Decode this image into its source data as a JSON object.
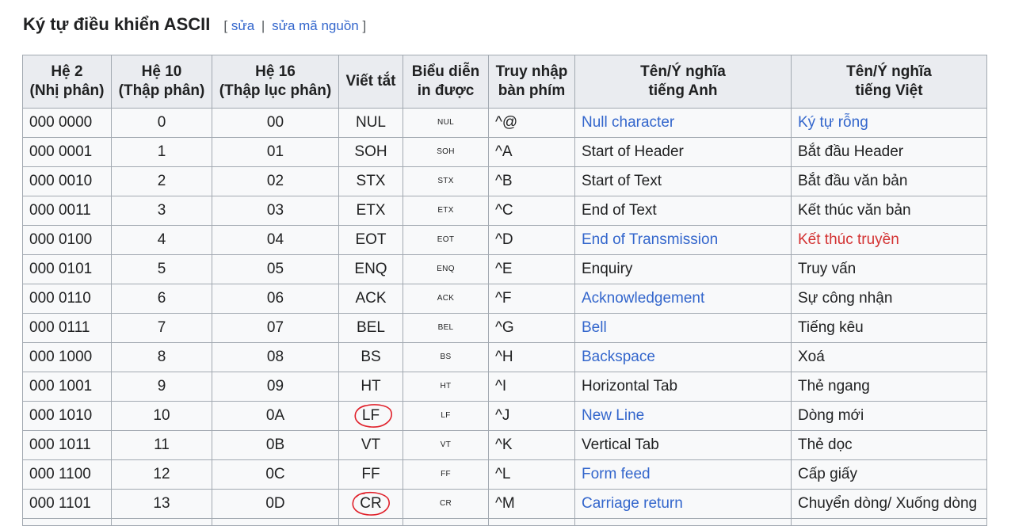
{
  "section": {
    "title": "Ký tự điều khiển ASCII",
    "edit_open": "[",
    "edit_label": "sửa",
    "separator": "|",
    "edit_source_label": "sửa mã nguồn",
    "edit_close": "]"
  },
  "table": {
    "headers": [
      {
        "line1": "Hệ 2",
        "line2": "(Nhị phân)"
      },
      {
        "line1": "Hệ 10",
        "line2": "(Thập phân)"
      },
      {
        "line1": "Hệ 16",
        "line2": "(Thập lục phân)"
      },
      {
        "line1": "Viết tắt",
        "line2": ""
      },
      {
        "line1": "Biểu diễn",
        "line2": "in được"
      },
      {
        "line1": "Truy nhập",
        "line2": "bàn phím"
      },
      {
        "line1": "Tên/Ý nghĩa",
        "line2": "tiếng Anh"
      },
      {
        "line1": "Tên/Ý nghĩa",
        "line2": "tiếng Việt"
      }
    ],
    "rows": [
      {
        "bin": "000 0000",
        "dec": "0",
        "hex": "00",
        "abbr": "NUL",
        "printable": "NUL",
        "key": "^@",
        "en": "Null character",
        "vi": "Ký tự rỗng"
      },
      {
        "bin": "000 0001",
        "dec": "1",
        "hex": "01",
        "abbr": "SOH",
        "printable": "SOH",
        "key": "^A",
        "en": "Start of Header",
        "vi": "Bắt đầu Header"
      },
      {
        "bin": "000 0010",
        "dec": "2",
        "hex": "02",
        "abbr": "STX",
        "printable": "STX",
        "key": "^B",
        "en": "Start of Text",
        "vi": "Bắt đầu văn bản"
      },
      {
        "bin": "000 0011",
        "dec": "3",
        "hex": "03",
        "abbr": "ETX",
        "printable": "ETX",
        "key": "^C",
        "en": "End of Text",
        "vi": "Kết thúc văn bản"
      },
      {
        "bin": "000 0100",
        "dec": "4",
        "hex": "04",
        "abbr": "EOT",
        "printable": "EOT",
        "key": "^D",
        "en": "End of Transmission",
        "vi": "Kết thúc truyền"
      },
      {
        "bin": "000 0101",
        "dec": "5",
        "hex": "05",
        "abbr": "ENQ",
        "printable": "ENQ",
        "key": "^E",
        "en": "Enquiry",
        "vi": "Truy vấn"
      },
      {
        "bin": "000 0110",
        "dec": "6",
        "hex": "06",
        "abbr": "ACK",
        "printable": "ACK",
        "key": "^F",
        "en": "Acknowledgement",
        "vi": "Sự công nhận"
      },
      {
        "bin": "000 0111",
        "dec": "7",
        "hex": "07",
        "abbr": "BEL",
        "printable": "BEL",
        "key": "^G",
        "en": "Bell",
        "vi": "Tiếng kêu"
      },
      {
        "bin": "000 1000",
        "dec": "8",
        "hex": "08",
        "abbr": "BS",
        "printable": "BS",
        "key": "^H",
        "en": "Backspace",
        "vi": "Xoá"
      },
      {
        "bin": "000 1001",
        "dec": "9",
        "hex": "09",
        "abbr": "HT",
        "printable": "HT",
        "key": "^I",
        "en": "Horizontal Tab",
        "vi": "Thẻ ngang"
      },
      {
        "bin": "000 1010",
        "dec": "10",
        "hex": "0A",
        "abbr": "LF",
        "printable": "LF",
        "key": "^J",
        "en": "New Line",
        "vi": "Dòng mới"
      },
      {
        "bin": "000 1011",
        "dec": "11",
        "hex": "0B",
        "abbr": "VT",
        "printable": "VT",
        "key": "^K",
        "en": "Vertical Tab",
        "vi": "Thẻ dọc"
      },
      {
        "bin": "000 1100",
        "dec": "12",
        "hex": "0C",
        "abbr": "FF",
        "printable": "FF",
        "key": "^L",
        "en": "Form feed",
        "vi": "Cấp giấy"
      },
      {
        "bin": "000 1101",
        "dec": "13",
        "hex": "0D",
        "abbr": "CR",
        "printable": "CR",
        "key": "^M",
        "en": "Carriage return",
        "vi": "Chuyển dòng/ Xuống dòng"
      }
    ]
  },
  "colors": {
    "link": "#3366cc",
    "redlink": "#d33232",
    "annotation_circle": "#e0202a"
  }
}
